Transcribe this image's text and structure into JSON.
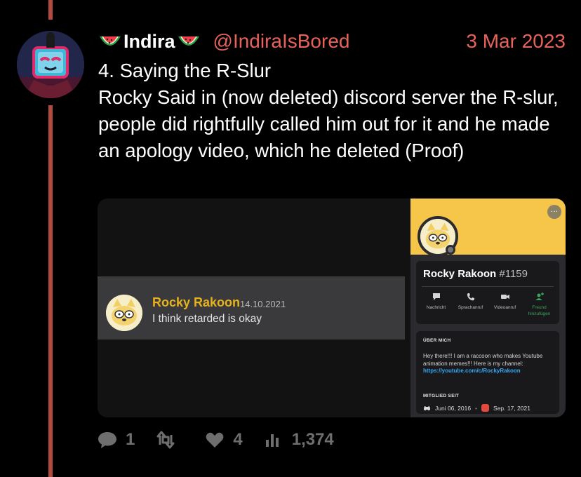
{
  "tweet": {
    "display_name": "Indira",
    "handle": "@IndiraIsBored",
    "date": "3 Mar 2023",
    "text_lines": [
      "4. Saying the R-Slur",
      "Rocky Said in (now deleted) discord server the R-slur, people did rightfully called him out for it and he made an apology video, which he deleted (Proof)"
    ]
  },
  "media": {
    "message": {
      "author": "Rocky Rakoon",
      "date": "14.10.2021",
      "text": "I think retarded is okay"
    },
    "profile": {
      "name": "Rocky Rakoon",
      "tag": "#1159",
      "more_label": "…",
      "actions": [
        {
          "label": "Nachricht",
          "icon": "message-icon"
        },
        {
          "label": "Sprachanruf",
          "icon": "phone-icon"
        },
        {
          "label": "Videoanruf",
          "icon": "video-icon"
        },
        {
          "label": "Freund hinzufügen",
          "icon": "add-friend-icon"
        }
      ],
      "about_heading": "ÜBER MICH",
      "about_text": "Hey there!!! I am a raccoon who makes Youtube animation memes!!! Here is my channel:",
      "about_link": "https://youtube.com/c/RockyRakoon",
      "member_since_heading": "MITGLIED SEIT",
      "discord_since": "Juni 06, 2016",
      "server_since": "Sep. 17, 2021",
      "banner_color": "#f6c64a"
    }
  },
  "engagement": {
    "replies": "1",
    "retweets": "",
    "likes": "4",
    "views": "1,374"
  },
  "colors": {
    "accent": "#e8625a",
    "thread_line": "#b34a3f",
    "muted": "#6e6e6e"
  }
}
